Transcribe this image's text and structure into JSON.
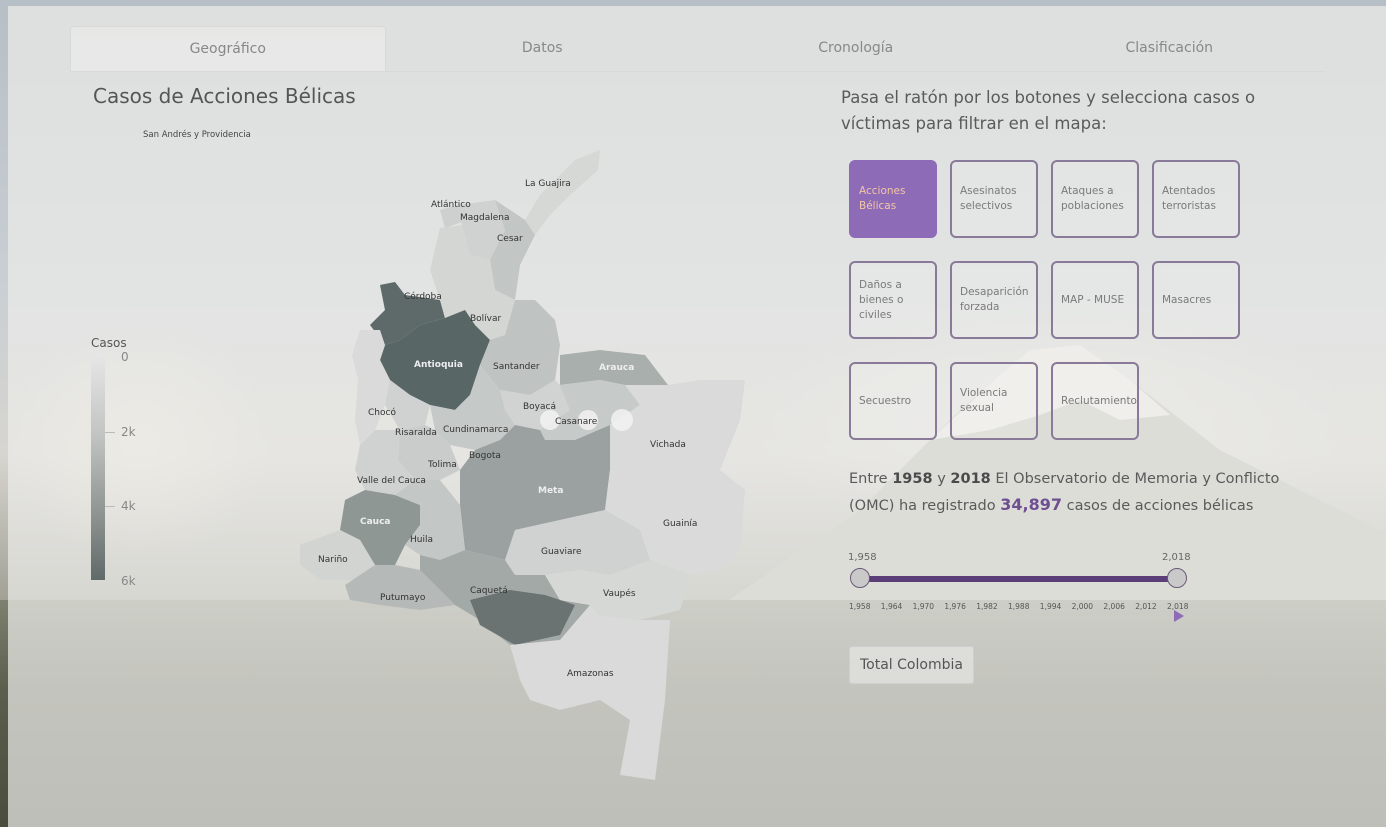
{
  "tabs": [
    "Geográfico",
    "Datos",
    "Cronología",
    "Clasificación"
  ],
  "map": {
    "title": "Casos de Acciones Bélicas",
    "island_label": "San Andrés y Providencia",
    "departments": [
      "La Guajira",
      "Atlántico",
      "Magdalena",
      "Cesar",
      "Córdoba",
      "Bolívar",
      "Antioquia",
      "Santander",
      "Arauca",
      "Boyacá",
      "Casanare",
      "Vichada",
      "Chocó",
      "Risaralda",
      "Cundinamarca",
      "Bogota",
      "Tolima",
      "Valle del Cauca",
      "Meta",
      "Cauca",
      "Huila",
      "Guainía",
      "Nariño",
      "Guaviare",
      "Putumayo",
      "Caquetá",
      "Vaupés",
      "Amazonas"
    ]
  },
  "legend": {
    "title": "Casos",
    "labels": [
      "0",
      "2k",
      "4k",
      "6k"
    ]
  },
  "intro_text": "Pasa el ratón por los botones y selecciona casos o víctimas para filtrar en el mapa:",
  "buttons": [
    "Acciones Bélicas",
    "Asesinatos selectivos",
    "Ataques a poblaciones",
    "Atentados terroristas",
    "Daños a bienes o civiles",
    "Desaparición forzada",
    "MAP - MUSE",
    "Masacres",
    "Secuestro",
    "Violencia sexual",
    "Reclutamiento"
  ],
  "summary": {
    "prefix": "Entre",
    "start": "1958",
    "mid": "y",
    "end": "2018",
    "middle_text": "El Observatorio de Memoria y Conflicto (OMC) ha registrado",
    "count": "34,897",
    "suffix": "casos de acciones bélicas"
  },
  "slider": {
    "min_label": "1,958",
    "max_label": "2,018",
    "min": 1958,
    "max": 2018,
    "value_start": 1958,
    "value_end": 2018,
    "axis": [
      "1,958",
      "1,964",
      "1,970",
      "1,976",
      "1,982",
      "1,988",
      "1,994",
      "2,000",
      "2,006",
      "2,012",
      "2,018"
    ]
  },
  "total_button": "Total Colombia",
  "colors": {
    "accent": "#8e6bb7",
    "accent_text": "#f3c7a3",
    "dark_dept": "#586665",
    "track": "#5b3d78"
  }
}
